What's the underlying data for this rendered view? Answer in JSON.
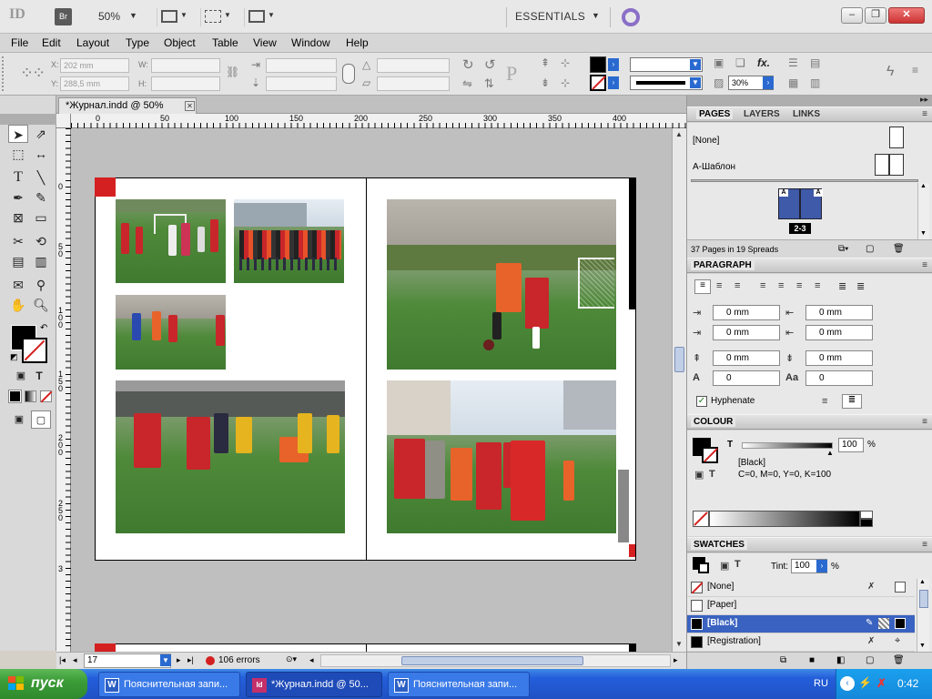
{
  "app": {
    "logo": "ID",
    "bridge": "Br",
    "zoom": "50%",
    "workspace": "ESSENTIALS"
  },
  "menu": [
    "File",
    "Edit",
    "Layout",
    "Type",
    "Object",
    "Table",
    "View",
    "Window",
    "Help"
  ],
  "control": {
    "x_label": "X:",
    "x_value": "202 mm",
    "y_label": "Y:",
    "y_value": "288,5 mm",
    "w_label": "W:",
    "h_label": "H:",
    "opacity": "30%",
    "fx": "fx."
  },
  "document": {
    "tab_title": "*Журнал.indd @ 50%",
    "current_page": "17",
    "errors": "106 errors"
  },
  "ruler": {
    "h_ticks": [
      "0",
      "50",
      "100",
      "150",
      "200",
      "250",
      "300",
      "350",
      "400"
    ],
    "v_ticks": [
      "0",
      "5",
      "0",
      "1",
      "0",
      "0",
      "1",
      "5",
      "0",
      "2",
      "0",
      "0",
      "2",
      "5",
      "0",
      "3"
    ]
  },
  "panels": {
    "pages": {
      "tabs": [
        "PAGES",
        "LAYERS",
        "LINKS"
      ],
      "masters": [
        "[None]",
        "A-Шаблон"
      ],
      "spread_label": "2-3",
      "master_marker": "A",
      "summary": "37 Pages in 19 Spreads"
    },
    "paragraph": {
      "title": "PARAGRAPH",
      "left_indent": "0 mm",
      "right_indent": "0 mm",
      "first_line": "0 mm",
      "last_line": "0 mm",
      "space_before": "0 mm",
      "space_after": "0 mm",
      "drop_lines": "0",
      "drop_chars": "0",
      "hyphenate": "Hyphenate"
    },
    "colour": {
      "title": "COLOUR",
      "tint": "100",
      "percent": "%",
      "name": "[Black]",
      "values": "C=0, M=0, Y=0, K=100",
      "t_label": "T"
    },
    "swatches": {
      "title": "SWATCHES",
      "tint_label": "Tint:",
      "tint": "100",
      "percent": "%",
      "items": [
        "[None]",
        "[Paper]",
        "[Black]",
        "[Registration]"
      ]
    }
  },
  "taskbar": {
    "start": "пуск",
    "tasks": [
      "Пояснительная запи...",
      "*Журнал.indd @ 50...",
      "Пояснительная запи..."
    ],
    "lang": "RU",
    "clock": "0:42"
  },
  "colors": {
    "accent_red": "#d42020",
    "selection_blue": "#3a62c0",
    "taskbar_blue": "#245edb"
  }
}
